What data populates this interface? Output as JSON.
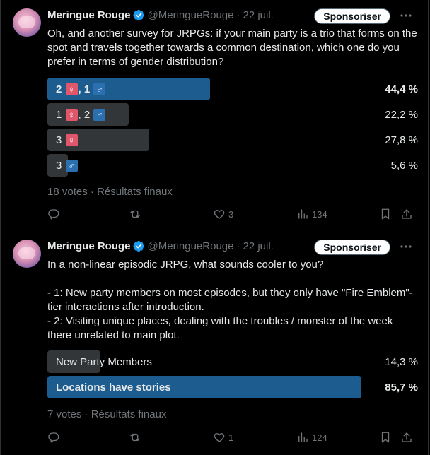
{
  "colors": {
    "background": "#000000",
    "text": "#e7e9ea",
    "muted": "#71767b",
    "winner_bar": "#1d5c8f",
    "bar": "#333639",
    "verified": "#1d9bf0",
    "female_badge": "#e0576b",
    "male_badge": "#2a6fb0"
  },
  "tweets": [
    {
      "author_name": "Meringue Rouge",
      "handle": "@MeringueRouge",
      "separator": "·",
      "date": "22 juil.",
      "sponsor_label": "Sponsoriser",
      "text": "Oh, and another survey for JRPGs: if your main party is a trio that forms on the spot and travels together towards a common destination, which one do you prefer in terms of gender distribution?",
      "poll": {
        "options": [
          {
            "parts": [
              {
                "t": "2 "
              },
              {
                "sym": "♀",
                "k": "f"
              },
              {
                "t": ", 1 "
              },
              {
                "sym": "♂",
                "k": "m"
              }
            ],
            "percent_label": "44,4 %",
            "percent": 44.4,
            "winner": true
          },
          {
            "parts": [
              {
                "t": "1 "
              },
              {
                "sym": "♀",
                "k": "f"
              },
              {
                "t": ", 2 "
              },
              {
                "sym": "♂",
                "k": "m"
              }
            ],
            "percent_label": "22,2 %",
            "percent": 22.2,
            "winner": false
          },
          {
            "parts": [
              {
                "t": "3 "
              },
              {
                "sym": "♀",
                "k": "f"
              }
            ],
            "percent_label": "27,8 %",
            "percent": 27.8,
            "winner": false
          },
          {
            "parts": [
              {
                "t": "3 "
              },
              {
                "sym": "♂",
                "k": "m"
              }
            ],
            "percent_label": "5,6 %",
            "percent": 5.6,
            "winner": false
          }
        ],
        "votes": "18 votes",
        "status": "Résultats finaux"
      },
      "actions": {
        "reply_icon": "reply-icon",
        "retweet_icon": "retweet-icon",
        "likes": "3",
        "views": "134"
      }
    },
    {
      "author_name": "Meringue Rouge",
      "handle": "@MeringueRouge",
      "separator": "·",
      "date": "22 juil.",
      "sponsor_label": "Sponsoriser",
      "text": "In a non-linear episodic JRPG, what sounds cooler to you?\n\n- 1: New party members on most episodes, but they only have \"Fire Emblem\"-tier interactions after introduction.\n- 2: Visiting unique places, dealing with the troubles / monster of the week there unrelated to main plot.",
      "poll": {
        "options": [
          {
            "parts": [
              {
                "t": "New Party Members"
              }
            ],
            "percent_label": "14,3 %",
            "percent": 14.3,
            "winner": false
          },
          {
            "parts": [
              {
                "t": "Locations have stories"
              }
            ],
            "percent_label": "85,7 %",
            "percent": 85.7,
            "winner": true
          }
        ],
        "votes": "7 votes",
        "status": "Résultats finaux"
      },
      "actions": {
        "reply_icon": "reply-icon",
        "retweet_icon": "retweet-icon",
        "likes": "1",
        "views": "124"
      }
    }
  ]
}
